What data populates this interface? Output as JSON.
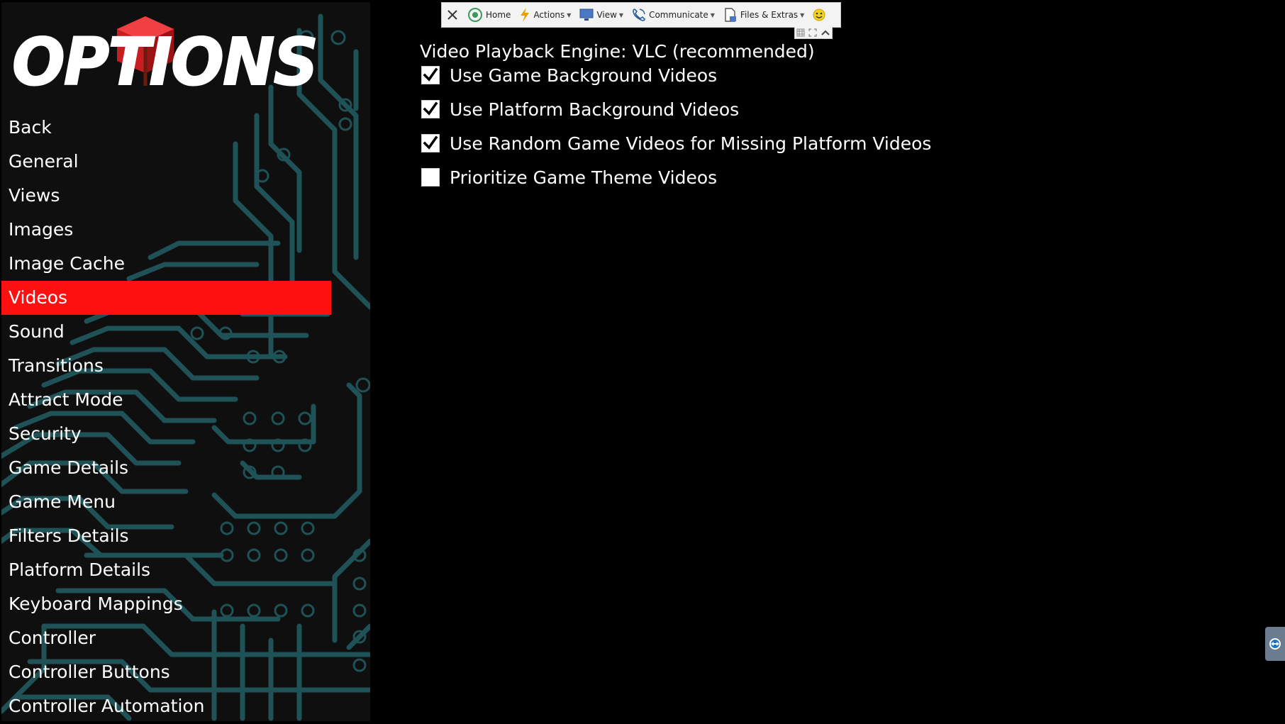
{
  "logo_text": "OPTIONS",
  "menu": {
    "items": [
      {
        "label": "Back"
      },
      {
        "label": "General"
      },
      {
        "label": "Views"
      },
      {
        "label": "Images"
      },
      {
        "label": "Image Cache"
      },
      {
        "label": "Videos",
        "selected": true
      },
      {
        "label": "Sound"
      },
      {
        "label": "Transitions"
      },
      {
        "label": "Attract Mode"
      },
      {
        "label": "Security"
      },
      {
        "label": "Game Details"
      },
      {
        "label": "Game Menu"
      },
      {
        "label": "Filters Details"
      },
      {
        "label": "Platform Details"
      },
      {
        "label": "Keyboard Mappings"
      },
      {
        "label": "Controller"
      },
      {
        "label": "Controller Buttons"
      },
      {
        "label": "Controller Automation"
      }
    ]
  },
  "content": {
    "engine_label": "Video Playback Engine: VLC (recommended)",
    "options": [
      {
        "label": "Use Game Background Videos",
        "checked": true
      },
      {
        "label": "Use Platform Background Videos",
        "checked": true
      },
      {
        "label": "Use Random Game Videos for Missing Platform Videos",
        "checked": true
      },
      {
        "label": "Prioritize Game Theme Videos",
        "checked": false
      }
    ]
  },
  "toolbar": {
    "home_label": "Home",
    "actions_label": "Actions",
    "view_label": "View",
    "communicate_label": "Communicate",
    "files_label": "Files & Extras"
  },
  "colors": {
    "selected_bg": "#ff1010",
    "circuit": "#1e5256",
    "sidebar_bg": "#0f0f10",
    "logo_red": "#e8262b"
  }
}
